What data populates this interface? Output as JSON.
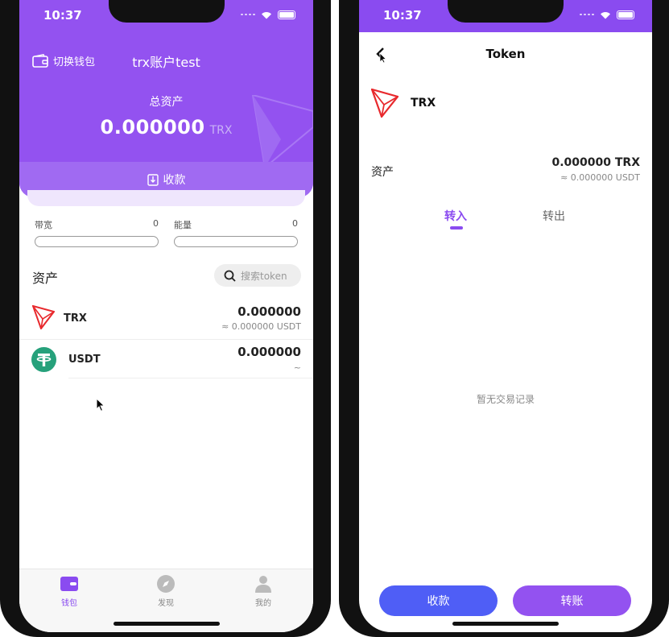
{
  "colors": {
    "accent": "#9352f0",
    "receive_button": "#4f5ef6",
    "send_button": "#9352f0"
  },
  "left": {
    "status_time": "10:37",
    "switch_wallet": "切换钱包",
    "account_name": "trx账户test",
    "total_label": "总资产",
    "total_value": "0.000000",
    "total_unit": "TRX",
    "receive_label": "收款",
    "bandwidth": {
      "label": "带宽",
      "value": "0"
    },
    "energy": {
      "label": "能量",
      "value": "0"
    },
    "assets_title": "资产",
    "search_placeholder": "搜索token",
    "tokens": [
      {
        "name": "TRX",
        "amount": "0.000000",
        "sub": "≈ 0.000000  USDT",
        "icon": "tron-logo-icon"
      },
      {
        "name": "USDT",
        "amount": "0.000000",
        "sub": "~",
        "icon": "tether-logo-icon"
      }
    ],
    "tabs": [
      {
        "label": "钱包",
        "icon": "wallet-icon",
        "active": true
      },
      {
        "label": "发现",
        "icon": "compass-icon",
        "active": false
      },
      {
        "label": "我的",
        "icon": "user-icon",
        "active": false
      }
    ]
  },
  "right": {
    "status_time": "10:37",
    "title": "Token",
    "token_name": "TRX",
    "asset_label": "资产",
    "asset_value": "0.000000 TRX",
    "asset_sub": "≈ 0.000000 USDT",
    "tab_in": "转入",
    "tab_out": "转出",
    "empty_text": "暂无交易记录",
    "receive_button": "收款",
    "transfer_button": "转账"
  }
}
